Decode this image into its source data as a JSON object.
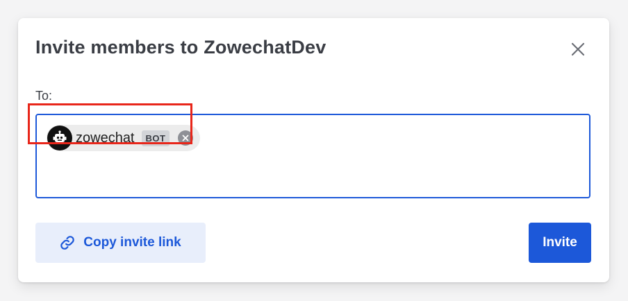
{
  "modal": {
    "title_prefix": "Invite members to",
    "team_name": "ZowechatDev",
    "close_icon": "close-icon"
  },
  "to_field": {
    "label": "To:",
    "selected": [
      {
        "name": "zowechat",
        "badge": "BOT",
        "avatar_icon": "robot-icon",
        "remove_icon": "remove-circle-icon"
      }
    ]
  },
  "footer": {
    "copy_link_label": "Copy invite link",
    "copy_link_icon": "link-icon",
    "invite_label": "Invite"
  },
  "colors": {
    "primary": "#1c58d9",
    "highlight": "#e8261a",
    "copy_link_bg": "#e8eefb"
  }
}
